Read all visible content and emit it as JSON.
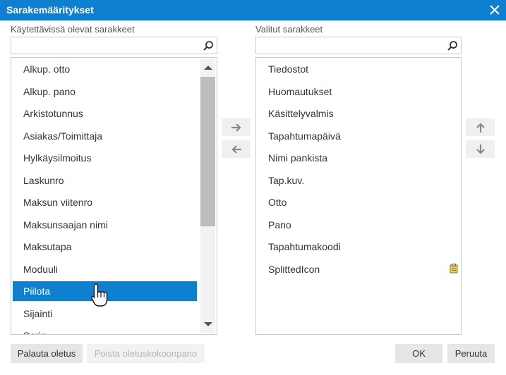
{
  "dialog": {
    "title": "Sarakemääritykset"
  },
  "available": {
    "label": "Käytettävissä olevat sarakkeet",
    "search_value": "",
    "items": [
      "Alkup. otto",
      "Alkup. pano",
      "Arkistotunnus",
      "Asiakas/Toimittaja",
      "Hylkäysilmoitus",
      "Laskunro",
      "Maksun viitenro",
      "Maksunsaajan nimi",
      "Maksutapa",
      "Moduuli",
      "Piilota",
      "Sijainti",
      "Sorja"
    ],
    "selected_item": "Piilota"
  },
  "selected": {
    "label": "Valitut sarakkeet",
    "search_value": "",
    "items": [
      "Tiedostot",
      "Huomautukset",
      "Käsittelyvalmis",
      "Tapahtumapäivä",
      "Nimi pankista",
      "Tap.kuv.",
      "Otto",
      "Pano",
      "Tapahtumakoodi",
      "SplittedIcon"
    ]
  },
  "footer": {
    "restore_default": "Palauta oletus",
    "remove_default": "Poista oletuskokoonpano",
    "ok": "OK",
    "cancel": "Peruuta"
  },
  "colors": {
    "titlebar": "#0f7fd0",
    "selection": "#0f7fd0",
    "button_bg": "#e6e6e6"
  },
  "icons": {
    "close": "close-icon",
    "search": "search-icon",
    "move_right": "arrow-right-icon",
    "move_left": "arrow-left-icon",
    "move_up": "arrow-up-icon",
    "move_down": "arrow-down-icon",
    "clip": "clipboard-icon",
    "cursor": "hand-pointer-icon"
  }
}
